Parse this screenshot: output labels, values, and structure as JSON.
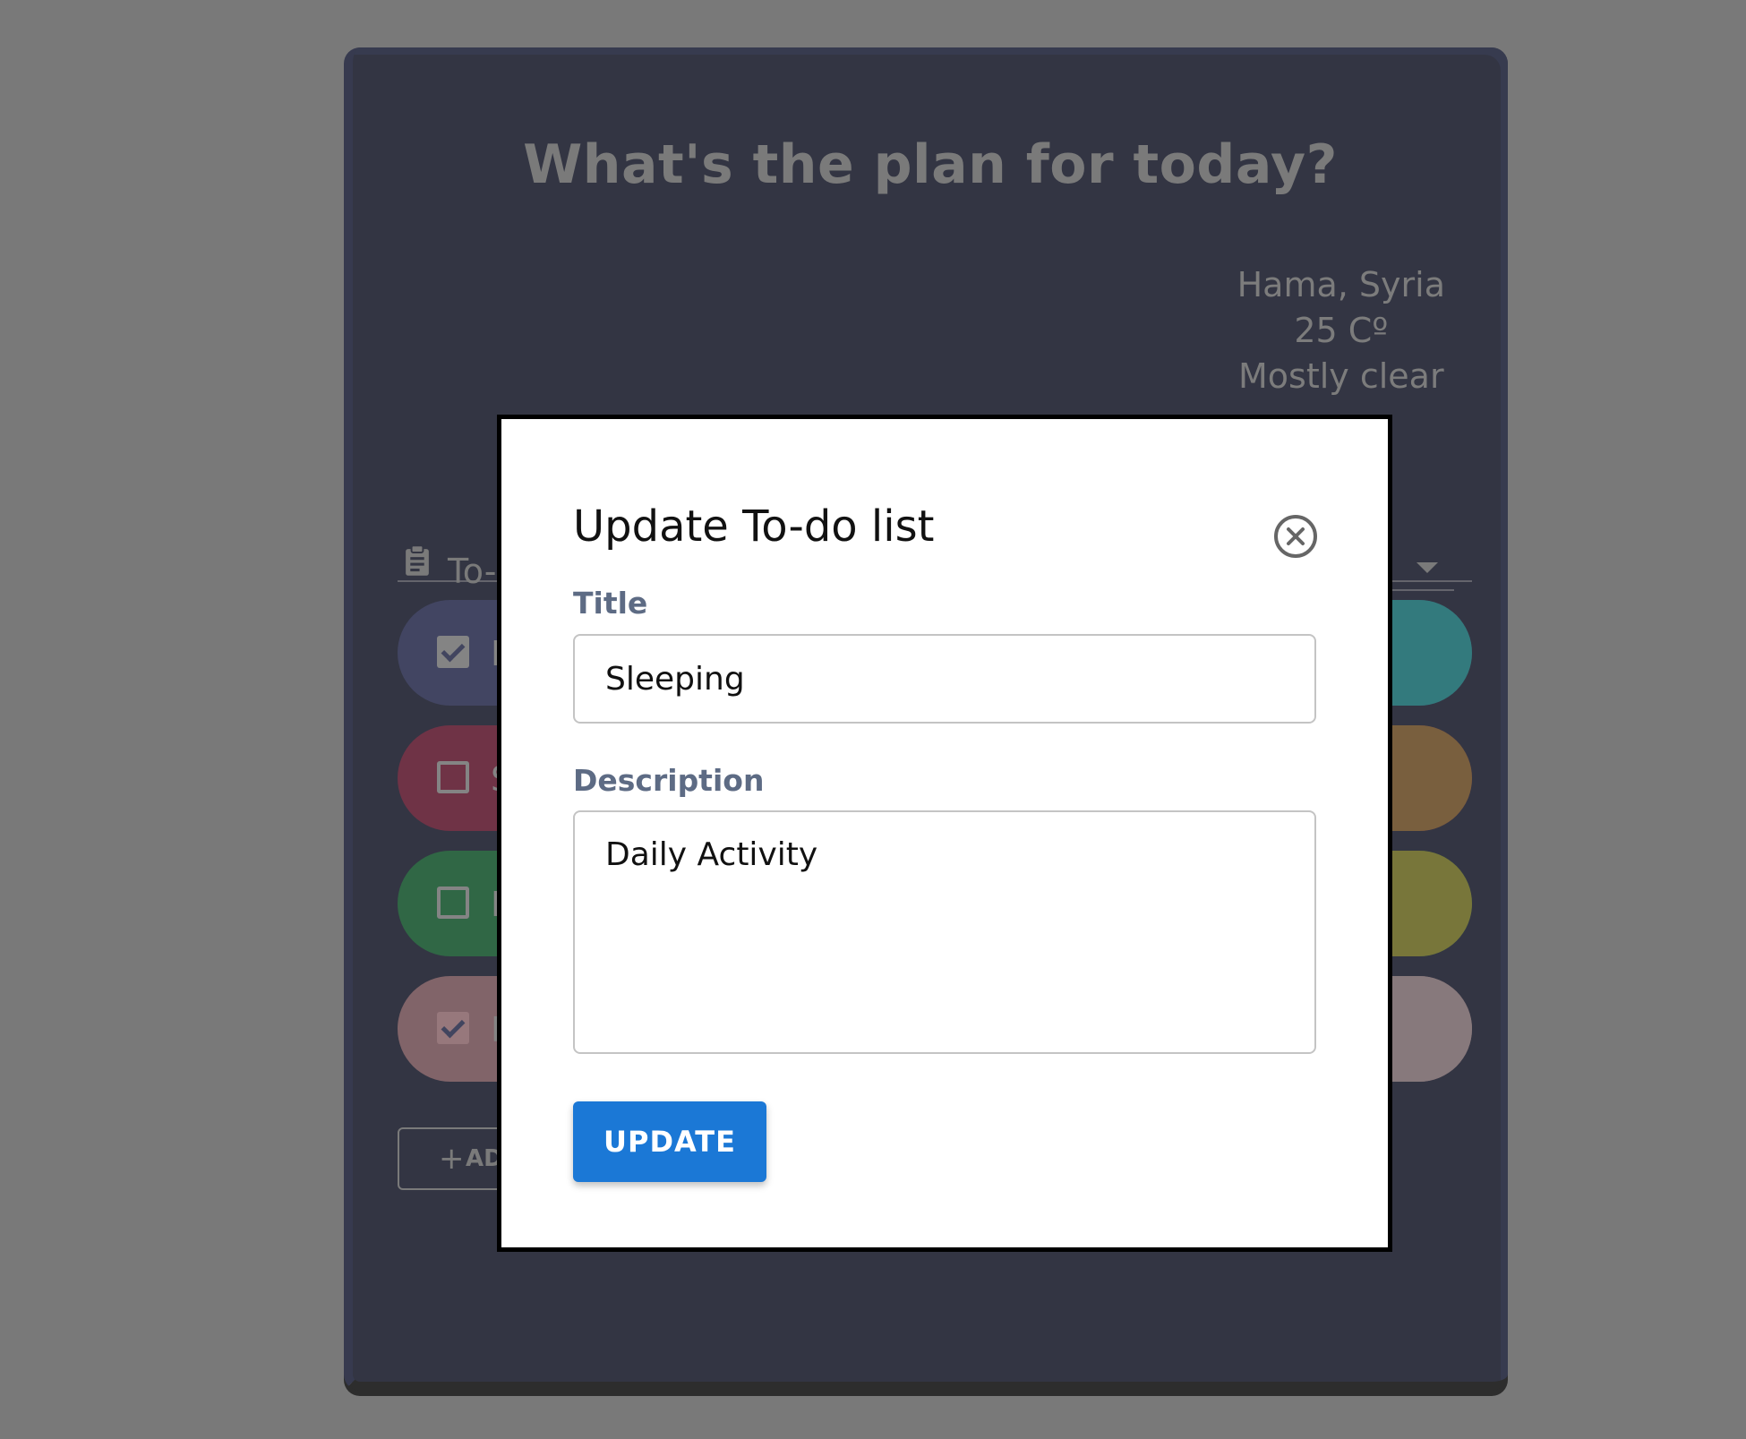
{
  "app": {
    "heading": "What's the plan for today?",
    "weather": {
      "location": "Hama, Syria",
      "temperature": "25 Cº",
      "condition": "Mostly clear"
    },
    "list_header": {
      "label": "To-d",
      "icon": "clipboard-icon"
    },
    "todos": [
      {
        "text": "H",
        "checked": true,
        "left_color": "#262a57",
        "right_color": "#0f7c80"
      },
      {
        "text": "S",
        "checked": false,
        "left_color": "#6a0e2c",
        "right_color": "#7a521f"
      },
      {
        "text": "H",
        "checked": false,
        "left_color": "#0a5e2a",
        "right_color": "#78751a"
      },
      {
        "text": "F",
        "checked": true,
        "left_color": "#865961",
        "right_color": "#8f7a7e"
      }
    ],
    "add_button": {
      "icon": "plus-icon",
      "plus": "+",
      "label": "ADD"
    }
  },
  "modal": {
    "title": "Update To-do list",
    "close_icon": "close-circle-icon",
    "title_field": {
      "label": "Title",
      "value": "Sleeping"
    },
    "description_field": {
      "label": "Description",
      "value": "Daily Activity"
    },
    "update_label": "UPDATE",
    "colors": {
      "primary": "#1b78d6",
      "label": "#5d6b84"
    }
  }
}
